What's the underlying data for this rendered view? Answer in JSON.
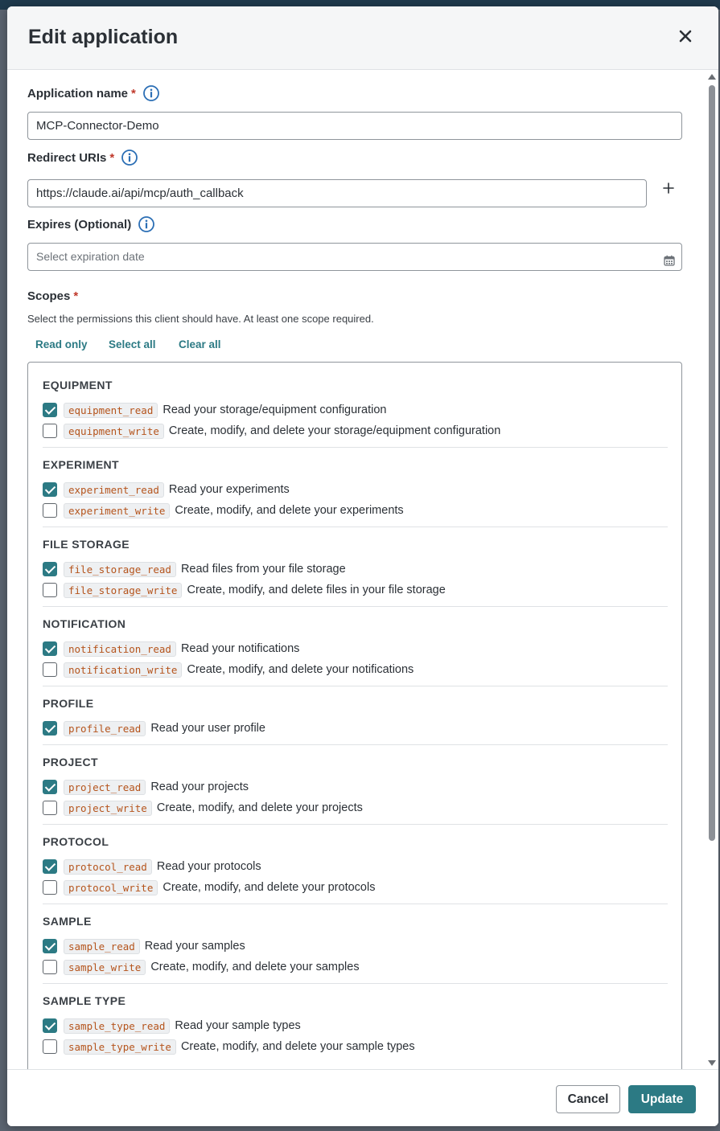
{
  "dialog": {
    "title": "Edit application",
    "close_icon": "close-icon"
  },
  "form": {
    "app_name": {
      "label": "Application name",
      "required": "*",
      "value": "MCP-Connector-Demo"
    },
    "redirect_uris": {
      "label": "Redirect URIs",
      "required": "*",
      "value": "https://claude.ai/api/mcp/auth_callback"
    },
    "expires": {
      "label": "Expires (Optional)",
      "placeholder": "Select expiration date"
    },
    "scopes": {
      "label": "Scopes",
      "required": "*",
      "description": "Select the permissions this client should have. At least one scope required.",
      "quick_actions": [
        "Read only",
        "Select all",
        "Clear all"
      ]
    }
  },
  "scope_groups": [
    {
      "title": "EQUIPMENT",
      "items": [
        {
          "code": "equipment_read",
          "desc": "Read your storage/equipment configuration",
          "checked": true
        },
        {
          "code": "equipment_write",
          "desc": "Create, modify, and delete your storage/equipment configuration",
          "checked": false
        }
      ]
    },
    {
      "title": "EXPERIMENT",
      "items": [
        {
          "code": "experiment_read",
          "desc": "Read your experiments",
          "checked": true
        },
        {
          "code": "experiment_write",
          "desc": "Create, modify, and delete your experiments",
          "checked": false
        }
      ]
    },
    {
      "title": "FILE STORAGE",
      "items": [
        {
          "code": "file_storage_read",
          "desc": "Read files from your file storage",
          "checked": true
        },
        {
          "code": "file_storage_write",
          "desc": "Create, modify, and delete files in your file storage",
          "checked": false
        }
      ]
    },
    {
      "title": "NOTIFICATION",
      "items": [
        {
          "code": "notification_read",
          "desc": "Read your notifications",
          "checked": true
        },
        {
          "code": "notification_write",
          "desc": "Create, modify, and delete your notifications",
          "checked": false
        }
      ]
    },
    {
      "title": "PROFILE",
      "items": [
        {
          "code": "profile_read",
          "desc": "Read your user profile",
          "checked": true
        }
      ]
    },
    {
      "title": "PROJECT",
      "items": [
        {
          "code": "project_read",
          "desc": "Read your projects",
          "checked": true
        },
        {
          "code": "project_write",
          "desc": "Create, modify, and delete your projects",
          "checked": false
        }
      ]
    },
    {
      "title": "PROTOCOL",
      "items": [
        {
          "code": "protocol_read",
          "desc": "Read your protocols",
          "checked": true
        },
        {
          "code": "protocol_write",
          "desc": "Create, modify, and delete your protocols",
          "checked": false
        }
      ]
    },
    {
      "title": "SAMPLE",
      "items": [
        {
          "code": "sample_read",
          "desc": "Read your samples",
          "checked": true
        },
        {
          "code": "sample_write",
          "desc": "Create, modify, and delete your samples",
          "checked": false
        }
      ]
    },
    {
      "title": "SAMPLE TYPE",
      "items": [
        {
          "code": "sample_type_read",
          "desc": "Read your sample types",
          "checked": true
        },
        {
          "code": "sample_type_write",
          "desc": "Create, modify, and delete your sample types",
          "checked": false
        }
      ]
    }
  ],
  "footer": {
    "cancel_label": "Cancel",
    "update_label": "Update"
  },
  "colors": {
    "accent": "#2c7a84",
    "required": "#c0392b",
    "code_text": "#b5541c"
  }
}
